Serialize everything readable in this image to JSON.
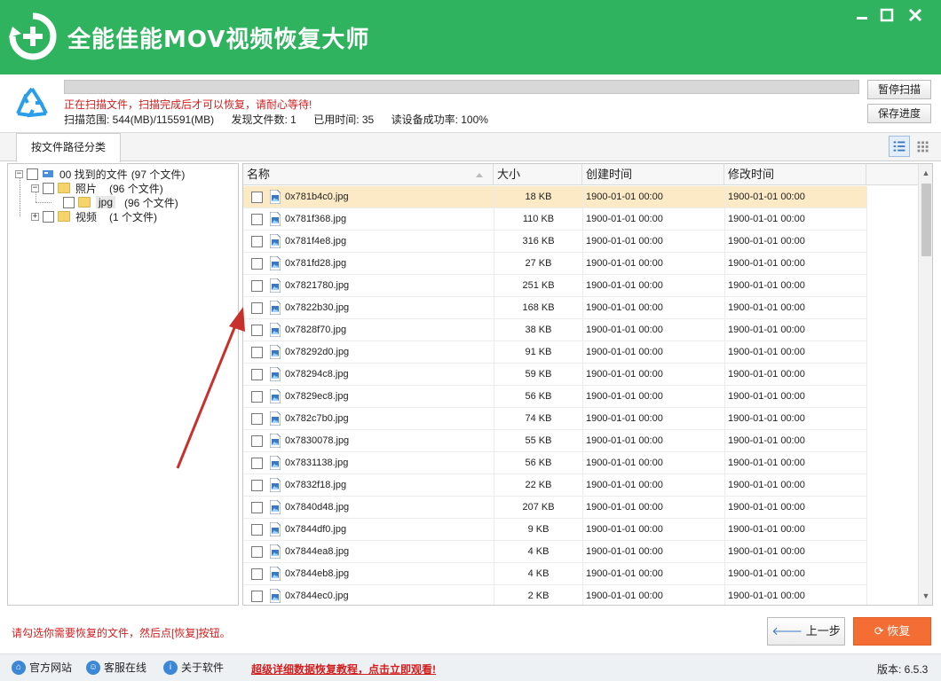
{
  "window": {
    "title": "全能佳能MOV视频恢复大师",
    "accent_color": "#2fb35f",
    "recover_color": "#f36d34"
  },
  "scan": {
    "message": "正在扫描文件，扫描完成后才可以恢复，请耐心等待!",
    "range": "扫描范围: 544(MB)/115591(MB)",
    "found": "发现文件数: 1",
    "elapsed": "已用时间: 35",
    "read_rate": "读设备成功率: 100%",
    "progress_fraction": 0,
    "pause_label": "暂停扫描",
    "save_label": "保存进度"
  },
  "tabs": {
    "by_path": "按文件路径分类"
  },
  "tree": {
    "root": {
      "label": "00 找到的文件",
      "count": "(97 个文件)"
    },
    "photos": {
      "label": "照片",
      "count": "(96 个文件)"
    },
    "jpg": {
      "label": "jpg",
      "count": "(96 个文件)"
    },
    "video": {
      "label": "视频",
      "count": "(1 个文件)"
    }
  },
  "list": {
    "columns": {
      "name": "名称",
      "size": "大小",
      "ctime": "创建时间",
      "mtime": "修改时间"
    },
    "rows": [
      {
        "name": "0x781b4c0.jpg",
        "size": "18 KB",
        "ctime": "1900-01-01  00:00",
        "mtime": "1900-01-01  00:00"
      },
      {
        "name": "0x781f368.jpg",
        "size": "110 KB",
        "ctime": "1900-01-01  00:00",
        "mtime": "1900-01-01  00:00"
      },
      {
        "name": "0x781f4e8.jpg",
        "size": "316 KB",
        "ctime": "1900-01-01  00:00",
        "mtime": "1900-01-01  00:00"
      },
      {
        "name": "0x781fd28.jpg",
        "size": "27 KB",
        "ctime": "1900-01-01  00:00",
        "mtime": "1900-01-01  00:00"
      },
      {
        "name": "0x7821780.jpg",
        "size": "251 KB",
        "ctime": "1900-01-01  00:00",
        "mtime": "1900-01-01  00:00"
      },
      {
        "name": "0x7822b30.jpg",
        "size": "168 KB",
        "ctime": "1900-01-01  00:00",
        "mtime": "1900-01-01  00:00"
      },
      {
        "name": "0x7828f70.jpg",
        "size": "38 KB",
        "ctime": "1900-01-01  00:00",
        "mtime": "1900-01-01  00:00"
      },
      {
        "name": "0x78292d0.jpg",
        "size": "91 KB",
        "ctime": "1900-01-01  00:00",
        "mtime": "1900-01-01  00:00"
      },
      {
        "name": "0x78294c8.jpg",
        "size": "59 KB",
        "ctime": "1900-01-01  00:00",
        "mtime": "1900-01-01  00:00"
      },
      {
        "name": "0x7829ec8.jpg",
        "size": "56 KB",
        "ctime": "1900-01-01  00:00",
        "mtime": "1900-01-01  00:00"
      },
      {
        "name": "0x782c7b0.jpg",
        "size": "74 KB",
        "ctime": "1900-01-01  00:00",
        "mtime": "1900-01-01  00:00"
      },
      {
        "name": "0x7830078.jpg",
        "size": "55 KB",
        "ctime": "1900-01-01  00:00",
        "mtime": "1900-01-01  00:00"
      },
      {
        "name": "0x7831138.jpg",
        "size": "56 KB",
        "ctime": "1900-01-01  00:00",
        "mtime": "1900-01-01  00:00"
      },
      {
        "name": "0x7832f18.jpg",
        "size": "22 KB",
        "ctime": "1900-01-01  00:00",
        "mtime": "1900-01-01  00:00"
      },
      {
        "name": "0x7840d48.jpg",
        "size": "207 KB",
        "ctime": "1900-01-01  00:00",
        "mtime": "1900-01-01  00:00"
      },
      {
        "name": "0x7844df0.jpg",
        "size": "9 KB",
        "ctime": "1900-01-01  00:00",
        "mtime": "1900-01-01  00:00"
      },
      {
        "name": "0x7844ea8.jpg",
        "size": "4 KB",
        "ctime": "1900-01-01  00:00",
        "mtime": "1900-01-01  00:00"
      },
      {
        "name": "0x7844eb8.jpg",
        "size": "4 KB",
        "ctime": "1900-01-01  00:00",
        "mtime": "1900-01-01  00:00"
      },
      {
        "name": "0x7844ec0.jpg",
        "size": "2 KB",
        "ctime": "1900-01-01  00:00",
        "mtime": "1900-01-01  00:00"
      }
    ]
  },
  "bottom": {
    "hint": "请勾选你需要恢复的文件，然后点[恢复]按钮。",
    "prev_label": "上一步",
    "recover_label": "恢复"
  },
  "footer": {
    "website": "官方网站",
    "support": "客服在线",
    "about": "关于软件",
    "tutorial": "超级详细数据恢复教程，点击立即观看!",
    "version": "版本: 6.5.3"
  }
}
